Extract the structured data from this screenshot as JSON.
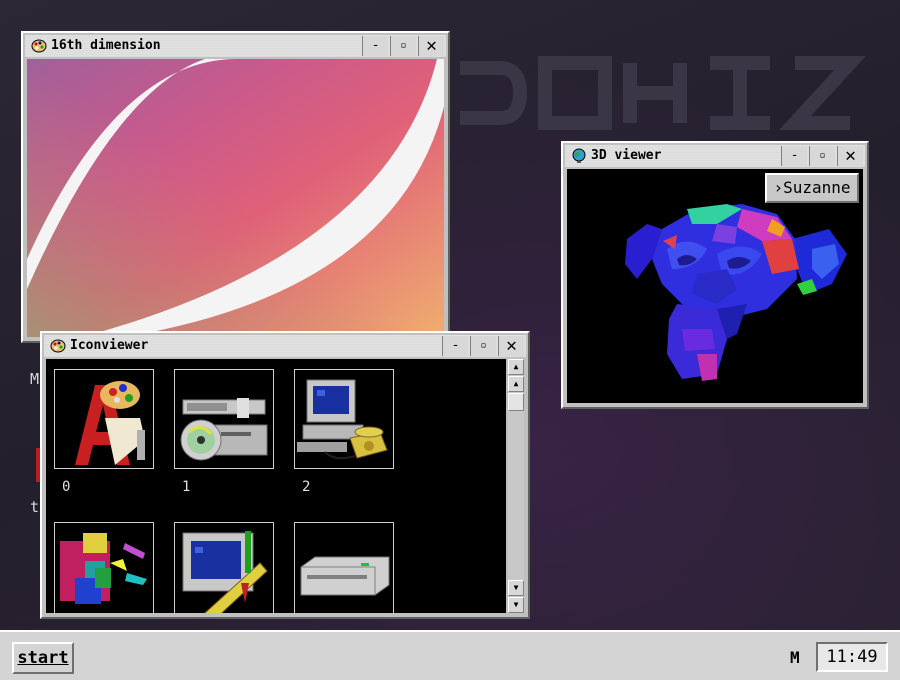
{
  "desktop": {
    "stub_letter": "M",
    "stub_letter2": "t"
  },
  "windows": {
    "dimension": {
      "title": "16th dimension",
      "minimize": "-",
      "maximize": "▫",
      "close": "✕"
    },
    "viewer3d": {
      "title": "3D viewer",
      "minimize": "-",
      "maximize": "▫",
      "close": "✕",
      "model_button": "›Suzanne"
    },
    "iconviewer": {
      "title": "Iconviewer",
      "minimize": "-",
      "maximize": "▫",
      "close": "✕",
      "icons": [
        {
          "label": "0",
          "icon": "paint-program-icon"
        },
        {
          "label": "1",
          "icon": "cd-drive-icon"
        },
        {
          "label": "2",
          "icon": "computer-phone-icon"
        },
        {
          "label": "",
          "icon": "shapes-icon"
        },
        {
          "label": "",
          "icon": "computer-ruler-icon"
        },
        {
          "label": "",
          "icon": "disk-drive-icon"
        }
      ],
      "scroll_up": "▲",
      "scroll_down": "▼"
    }
  },
  "taskbar": {
    "start_label": "start",
    "tray_indicator": "M",
    "clock": "11:49"
  },
  "colors": {
    "desktop": "#2a2534",
    "window_chrome": "#c0c0c0",
    "titlebar": "#e2e2e2",
    "taskbar": "#d4d4d4"
  }
}
